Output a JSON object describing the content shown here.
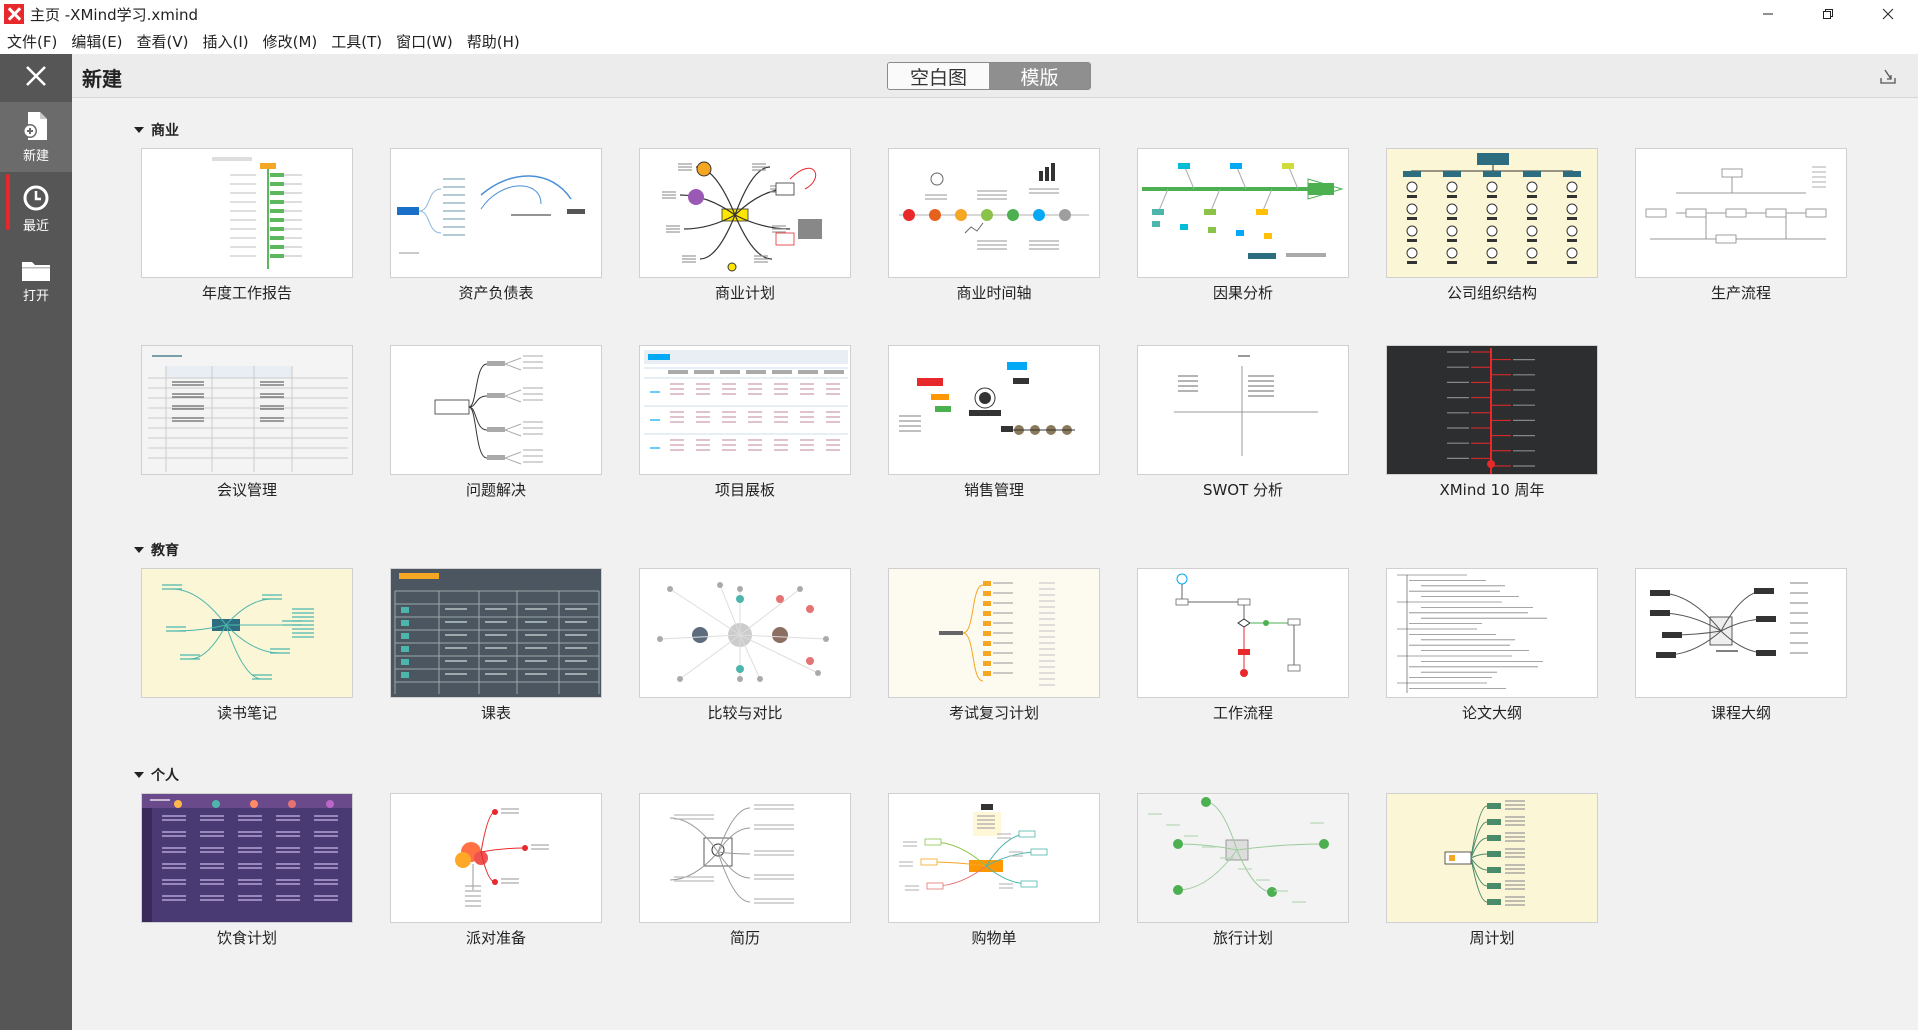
{
  "window": {
    "title": "主页 -XMind学习.xmind"
  },
  "menu": [
    "文件(F)",
    "编辑(E)",
    "查看(V)",
    "插入(I)",
    "修改(M)",
    "工具(T)",
    "窗口(W)",
    "帮助(H)"
  ],
  "sidebar": {
    "items": [
      {
        "label": "新建",
        "icon": "new-file-icon"
      },
      {
        "label": "最近",
        "icon": "clock-icon"
      },
      {
        "label": "打开",
        "icon": "folder-icon"
      }
    ]
  },
  "header": {
    "title": "新建",
    "tabs": [
      "空白图",
      "模版"
    ],
    "active_tab": "模版"
  },
  "sections": [
    {
      "title": "商业",
      "templates": [
        {
          "label": "年度工作报告",
          "style": "logic",
          "bg": "#ffffff"
        },
        {
          "label": "资产负债表",
          "style": "brace",
          "bg": "#ffffff"
        },
        {
          "label": "商业计划",
          "style": "mind",
          "bg": "#ffffff"
        },
        {
          "label": "商业时间轴",
          "style": "timeline",
          "bg": "#ffffff"
        },
        {
          "label": "因果分析",
          "style": "fishbone",
          "bg": "#ffffff"
        },
        {
          "label": "公司组织结构",
          "style": "org",
          "bg": "#fbf6d6"
        },
        {
          "label": "生产流程",
          "style": "flow",
          "bg": "#ffffff"
        },
        {
          "label": "会议管理",
          "style": "table",
          "bg": "#f4f4f4"
        },
        {
          "label": "问题解决",
          "style": "tree",
          "bg": "#ffffff"
        },
        {
          "label": "项目展板",
          "style": "board",
          "bg": "#ffffff"
        },
        {
          "label": "销售管理",
          "style": "mind2",
          "bg": "#ffffff"
        },
        {
          "label": "SWOT 分析",
          "style": "swot",
          "bg": "#ffffff"
        },
        {
          "label": "XMind 10 周年",
          "style": "dark",
          "bg": "#2d2e30"
        }
      ]
    },
    {
      "title": "教育",
      "templates": [
        {
          "label": "读书笔记",
          "style": "mind3",
          "bg": "#fbf6d6"
        },
        {
          "label": "课表",
          "style": "schedule",
          "bg": "#4b5660"
        },
        {
          "label": "比较与对比",
          "style": "bubble",
          "bg": "#ffffff"
        },
        {
          "label": "考试复习计划",
          "style": "brace2",
          "bg": "#fdfaf0"
        },
        {
          "label": "工作流程",
          "style": "flow2",
          "bg": "#ffffff"
        },
        {
          "label": "论文大纲",
          "style": "outline",
          "bg": "#ffffff"
        },
        {
          "label": "课程大纲",
          "style": "mind4",
          "bg": "#ffffff"
        }
      ]
    },
    {
      "title": "个人",
      "templates": [
        {
          "label": "饮食计划",
          "style": "purple",
          "bg": "#4a3a74"
        },
        {
          "label": "派对准备",
          "style": "party",
          "bg": "#ffffff"
        },
        {
          "label": "简历",
          "style": "resume",
          "bg": "#ffffff"
        },
        {
          "label": "购物单",
          "style": "shop",
          "bg": "#ffffff"
        },
        {
          "label": "旅行计划",
          "style": "travel",
          "bg": "#f3f3f3"
        },
        {
          "label": "周计划",
          "style": "week",
          "bg": "#fbf6d6"
        }
      ]
    }
  ],
  "colors": {
    "accent": "#e8292b",
    "sidebar": "#565656",
    "active_tab": "#8f8f8f"
  }
}
